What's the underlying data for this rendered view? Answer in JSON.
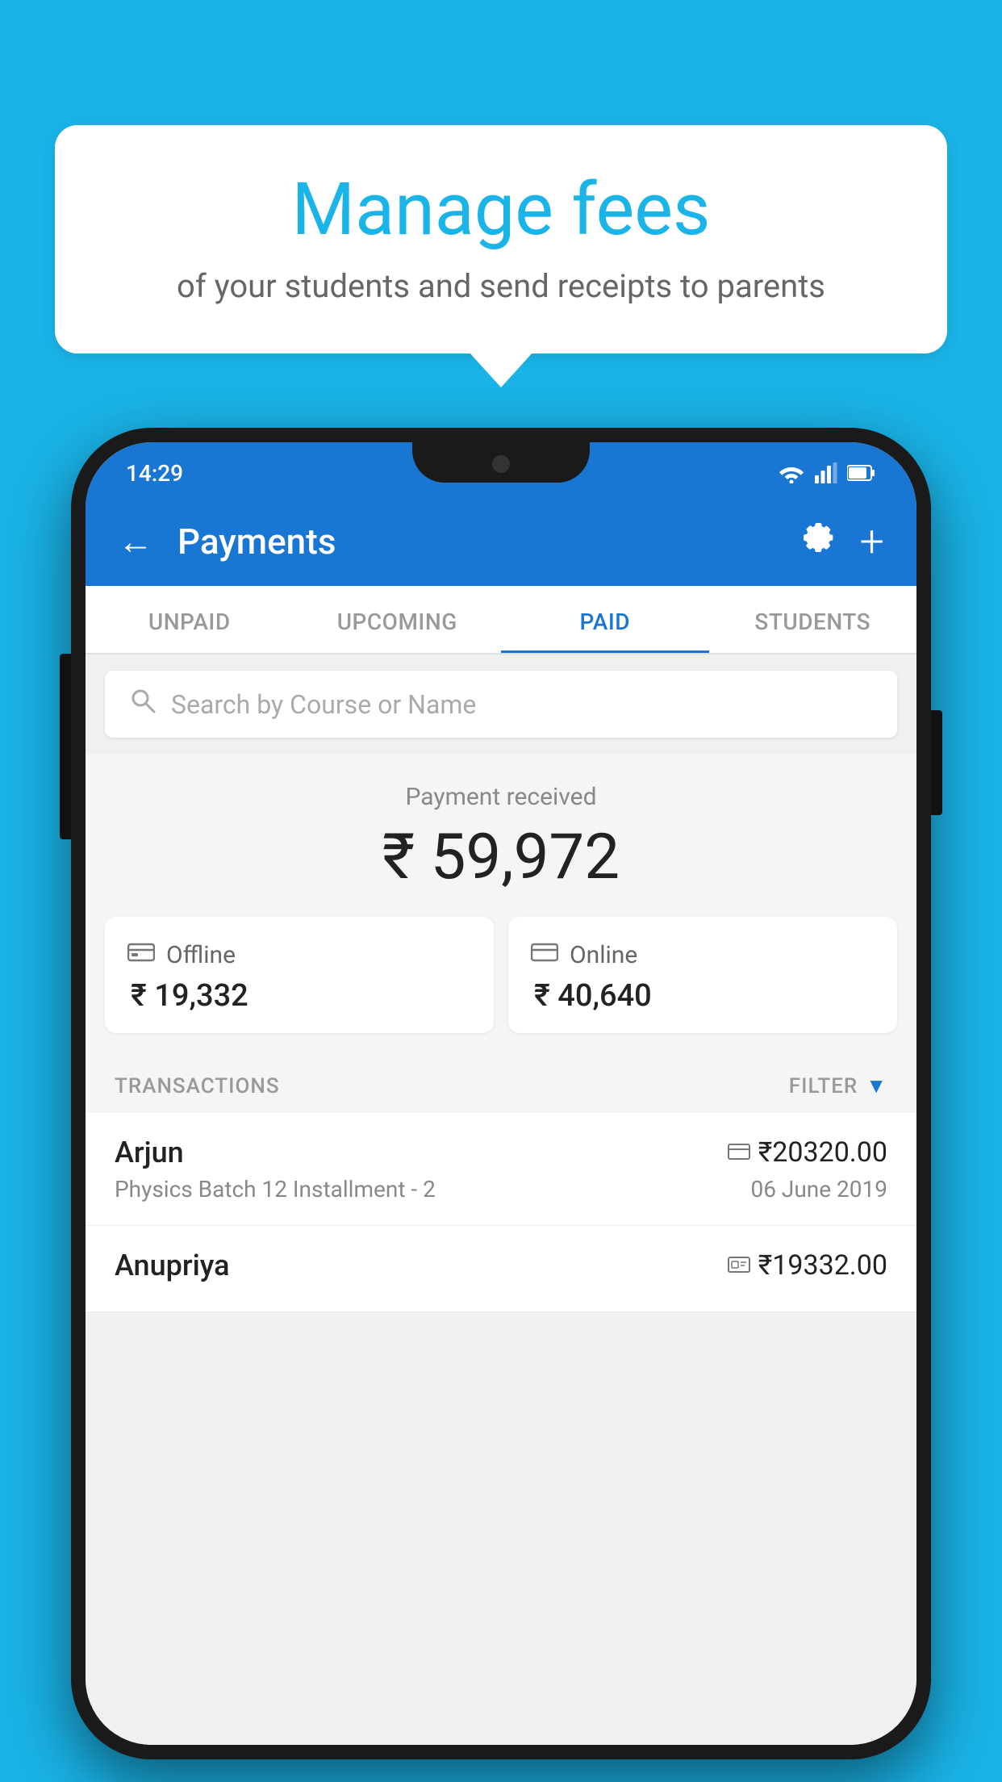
{
  "background_color": "#1ab4e8",
  "bubble": {
    "title": "Manage fees",
    "subtitle": "of your students and send receipts to parents"
  },
  "status_bar": {
    "time": "14:29",
    "icons": [
      "wifi",
      "signal",
      "battery"
    ]
  },
  "app_bar": {
    "title": "Payments",
    "back_icon": "←",
    "settings_icon": "⚙",
    "add_icon": "+"
  },
  "tabs": [
    {
      "label": "UNPAID",
      "active": false
    },
    {
      "label": "UPCOMING",
      "active": false
    },
    {
      "label": "PAID",
      "active": true
    },
    {
      "label": "STUDENTS",
      "active": false
    }
  ],
  "search": {
    "placeholder": "Search by Course or Name"
  },
  "payment_summary": {
    "label": "Payment received",
    "total": "₹ 59,972",
    "offline_label": "Offline",
    "offline_amount": "₹ 19,332",
    "online_label": "Online",
    "online_amount": "₹ 40,640"
  },
  "transactions_section": {
    "label": "TRANSACTIONS",
    "filter_label": "FILTER"
  },
  "transactions": [
    {
      "name": "Arjun",
      "course": "Physics Batch 12 Installment - 2",
      "amount": "₹20320.00",
      "date": "06 June 2019",
      "payment_type": "card"
    },
    {
      "name": "Anupriya",
      "course": "",
      "amount": "₹19332.00",
      "date": "",
      "payment_type": "cash"
    }
  ]
}
